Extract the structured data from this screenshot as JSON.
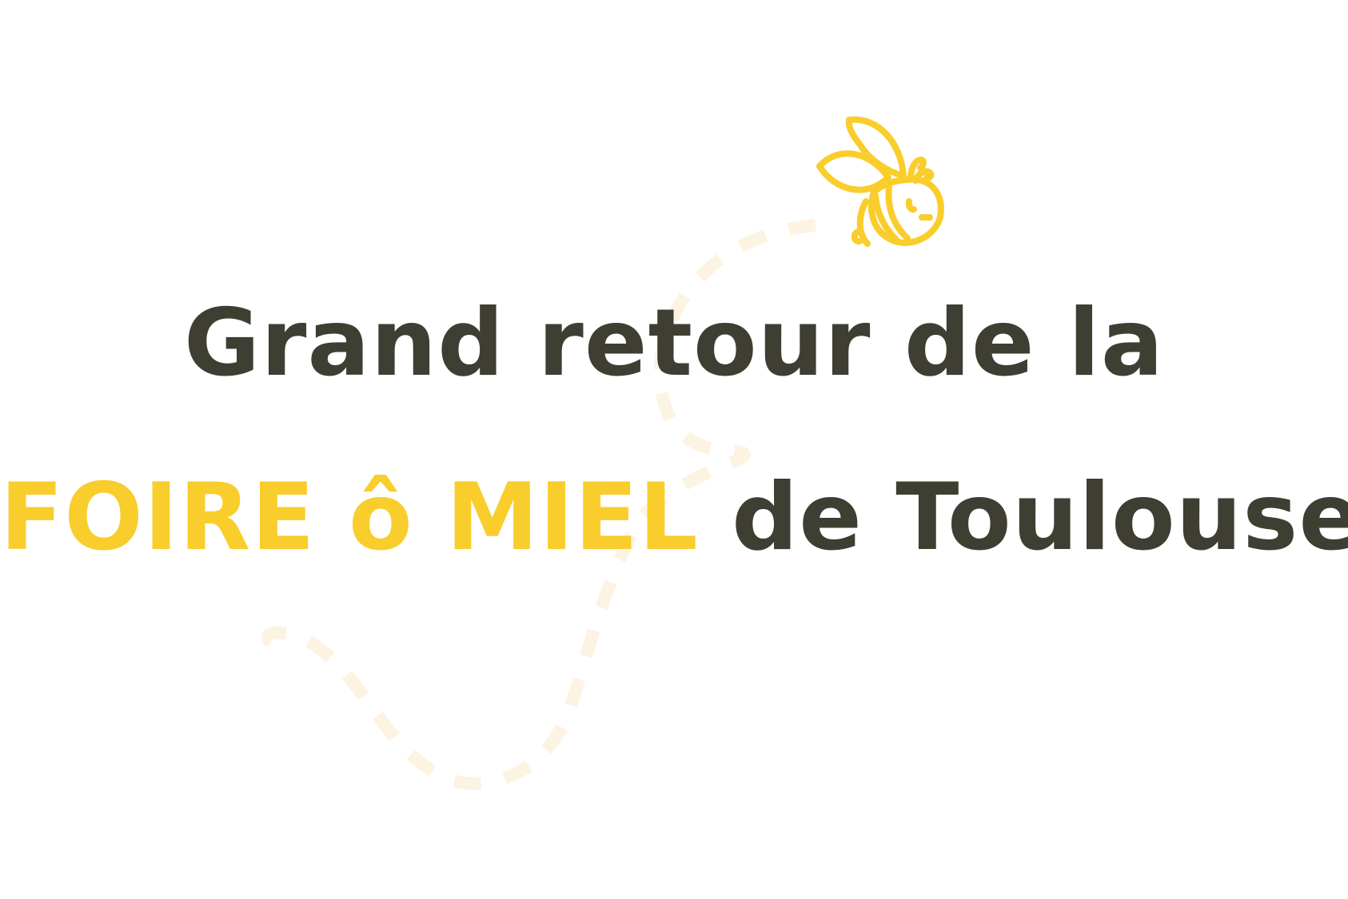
{
  "headline": {
    "line1": "Grand retour de la",
    "line2_accent": "FOIRE ô MIEL",
    "line2_rest": " de Toulouse !!"
  },
  "colors": {
    "background": "#ffffff",
    "text_dark": "#3f3e33",
    "accent_yellow": "#f9cd2b",
    "flight_path": "#fdf3e2"
  },
  "icons": {
    "bee": "bee-icon",
    "flight_path": "dashed-flight-path"
  }
}
